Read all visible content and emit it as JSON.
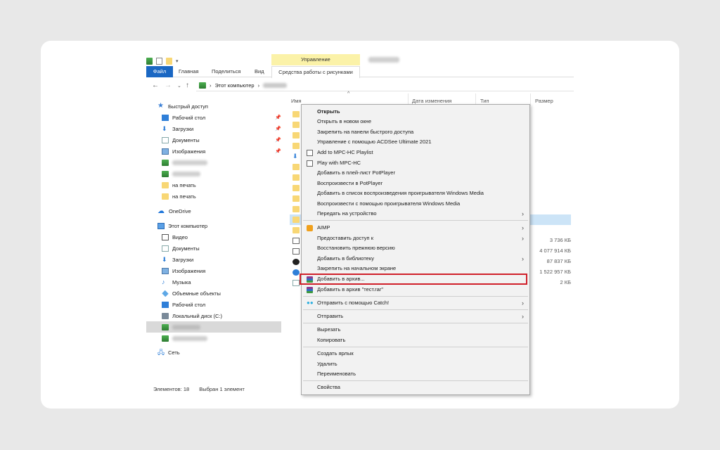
{
  "ribbon": {
    "manage_label": "Управление",
    "tabs": [
      "Файл",
      "Главная",
      "Поделиться",
      "Вид"
    ],
    "tools_tab": "Средства работы с рисунками"
  },
  "address": {
    "path": "Этот компьютер",
    "sep": "›"
  },
  "sidebar": {
    "quick_access": "Быстрый доступ",
    "desktop": "Рабочий стол",
    "downloads": "Загрузки",
    "documents": "Документы",
    "images": "Изображения",
    "print1": "на печать",
    "print2": "на печать",
    "onedrive": "OneDrive",
    "this_pc": "Этот компьютер",
    "video": "Видео",
    "pc_documents": "Документы",
    "pc_downloads": "Загрузки",
    "pc_images": "Изображения",
    "music": "Музыка",
    "objects3d": "Объемные объекты",
    "pc_desktop": "Рабочий стол",
    "local_disk": "Локальный диск (C:)",
    "network": "Сеть"
  },
  "status": {
    "items": "Элементов: 18",
    "selected": "Выбран 1 элемент"
  },
  "columns": {
    "name": "Имя",
    "date": "Дата изменения",
    "type": "Тип",
    "size": "Размер"
  },
  "sizes": [
    "3 736 КБ",
    "4 077 914 КБ",
    "87 837 КБ",
    "1 522 957 КБ",
    "2 КБ"
  ],
  "menu": {
    "open": "Открыть",
    "open_new": "Открыть в новом окне",
    "pin_quick": "Закрепить на панели быстрого доступа",
    "acdsee": "Управление с помощью ACDSee Ultimate 2021",
    "mpc_playlist": "Add to MPC-HC Playlist",
    "mpc_play": "Play with MPC-HC",
    "pot_add": "Добавить в плей-лист PotPlayer",
    "pot_play": "Воспроизвести в PotPlayer",
    "wmp_add": "Добавить в список воспроизведения проигрывателя Windows Media",
    "wmp_play": "Воспроизвести с помощью проигрывателя Windows Media",
    "send_device": "Передать на устройство",
    "aimp": "AIMP",
    "give_access": "Предоставить доступ к",
    "restore": "Восстановить прежнюю версию",
    "add_library": "Добавить в библиотеку",
    "pin_start": "Закрепить на начальном экране",
    "add_archive": "Добавить в архив...",
    "add_test_rar": "Добавить в архив \"тест.rar\"",
    "catch": "Отправить с помощью Catch!",
    "send_to": "Отправить",
    "cut": "Вырезать",
    "copy": "Копировать",
    "shortcut": "Создать ярлык",
    "delete": "Удалить",
    "rename": "Переименовать",
    "properties": "Свойства"
  },
  "colors": {
    "file_tab": "#1a67c3",
    "manage_tab": "#fbf2a8",
    "highlight_border": "#d0202a",
    "selection": "#cce4f7"
  }
}
